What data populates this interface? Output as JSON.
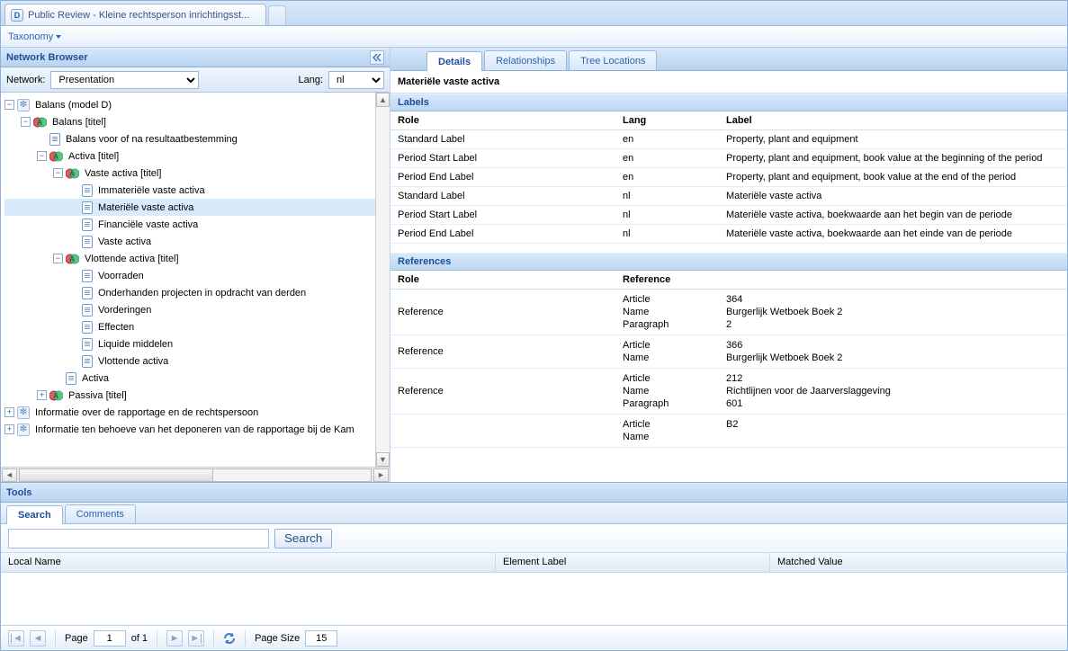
{
  "app_tab_title": "Public Review - Kleine rechtsperson inrichtingsst...",
  "menubar": {
    "taxonomy": "Taxonomy"
  },
  "network_browser": {
    "title": "Network Browser",
    "network_label": "Network:",
    "network_value": "Presentation",
    "lang_label": "Lang:",
    "lang_value": "nl"
  },
  "tree": {
    "n0": "Balans (model D)",
    "n1": "Balans [titel]",
    "n2": "Balans voor of na resultaatbestemming",
    "n3": "Activa [titel]",
    "n4": "Vaste activa [titel]",
    "n5": "Immateriële vaste activa",
    "n6": "Materiële vaste activa",
    "n7": "Financiële vaste activa",
    "n8": "Vaste activa",
    "n9": "Vlottende activa [titel]",
    "n10": "Voorraden",
    "n11": "Onderhanden projecten in opdracht van derden",
    "n12": "Vorderingen",
    "n13": "Effecten",
    "n14": "Liquide middelen",
    "n15": "Vlottende activa",
    "n16": "Activa",
    "n17": "Passiva [titel]",
    "n18": "Informatie over de rapportage en de rechtspersoon",
    "n19": "Informatie ten behoeve van het deponeren van de rapportage bij de Kam"
  },
  "details": {
    "tabs": {
      "details": "Details",
      "relationships": "Relationships",
      "tree_locations": "Tree Locations"
    },
    "concept_title": "Materiële vaste activa",
    "labels_section": "Labels",
    "labels_headers": {
      "role": "Role",
      "lang": "Lang",
      "label": "Label"
    },
    "labels_rows": [
      {
        "role": "Standard Label",
        "lang": "en",
        "label": "Property, plant and equipment"
      },
      {
        "role": "Period Start Label",
        "lang": "en",
        "label": "Property, plant and equipment, book value at the beginning of the period"
      },
      {
        "role": "Period End Label",
        "lang": "en",
        "label": "Property, plant and equipment, book value at the end of the period"
      },
      {
        "role": "Standard Label",
        "lang": "nl",
        "label": "Materiële vaste activa"
      },
      {
        "role": "Period Start Label",
        "lang": "nl",
        "label": "Materiële vaste activa, boekwaarde aan het begin van de periode"
      },
      {
        "role": "Period End Label",
        "lang": "nl",
        "label": "Materiële vaste activa, boekwaarde aan het einde van de periode"
      }
    ],
    "refs_section": "References",
    "refs_headers": {
      "role": "Role",
      "reference": "Reference"
    },
    "ref_keys": {
      "article": "Article",
      "name": "Name",
      "paragraph": "Paragraph"
    },
    "refs_rows": [
      {
        "role": "Reference",
        "article": "364",
        "name": "Burgerlijk Wetboek Boek 2",
        "paragraph": "2"
      },
      {
        "role": "Reference",
        "article": "366",
        "name": "Burgerlijk Wetboek Boek 2"
      },
      {
        "role": "Reference",
        "article": "212",
        "name": "Richtlijnen voor de Jaarverslaggeving",
        "paragraph": "601"
      },
      {
        "role": "",
        "article": "B2",
        "name": ""
      }
    ]
  },
  "tools": {
    "title": "Tools",
    "tabs": {
      "search": "Search",
      "comments": "Comments"
    },
    "search_button": "Search",
    "search_placeholder": "",
    "results_headers": {
      "local_name": "Local Name",
      "element_label": "Element Label",
      "matched_value": "Matched Value"
    }
  },
  "pager": {
    "page_label": "Page",
    "page_value": "1",
    "of_label": "of 1",
    "page_size_label": "Page Size",
    "page_size_value": "15"
  }
}
